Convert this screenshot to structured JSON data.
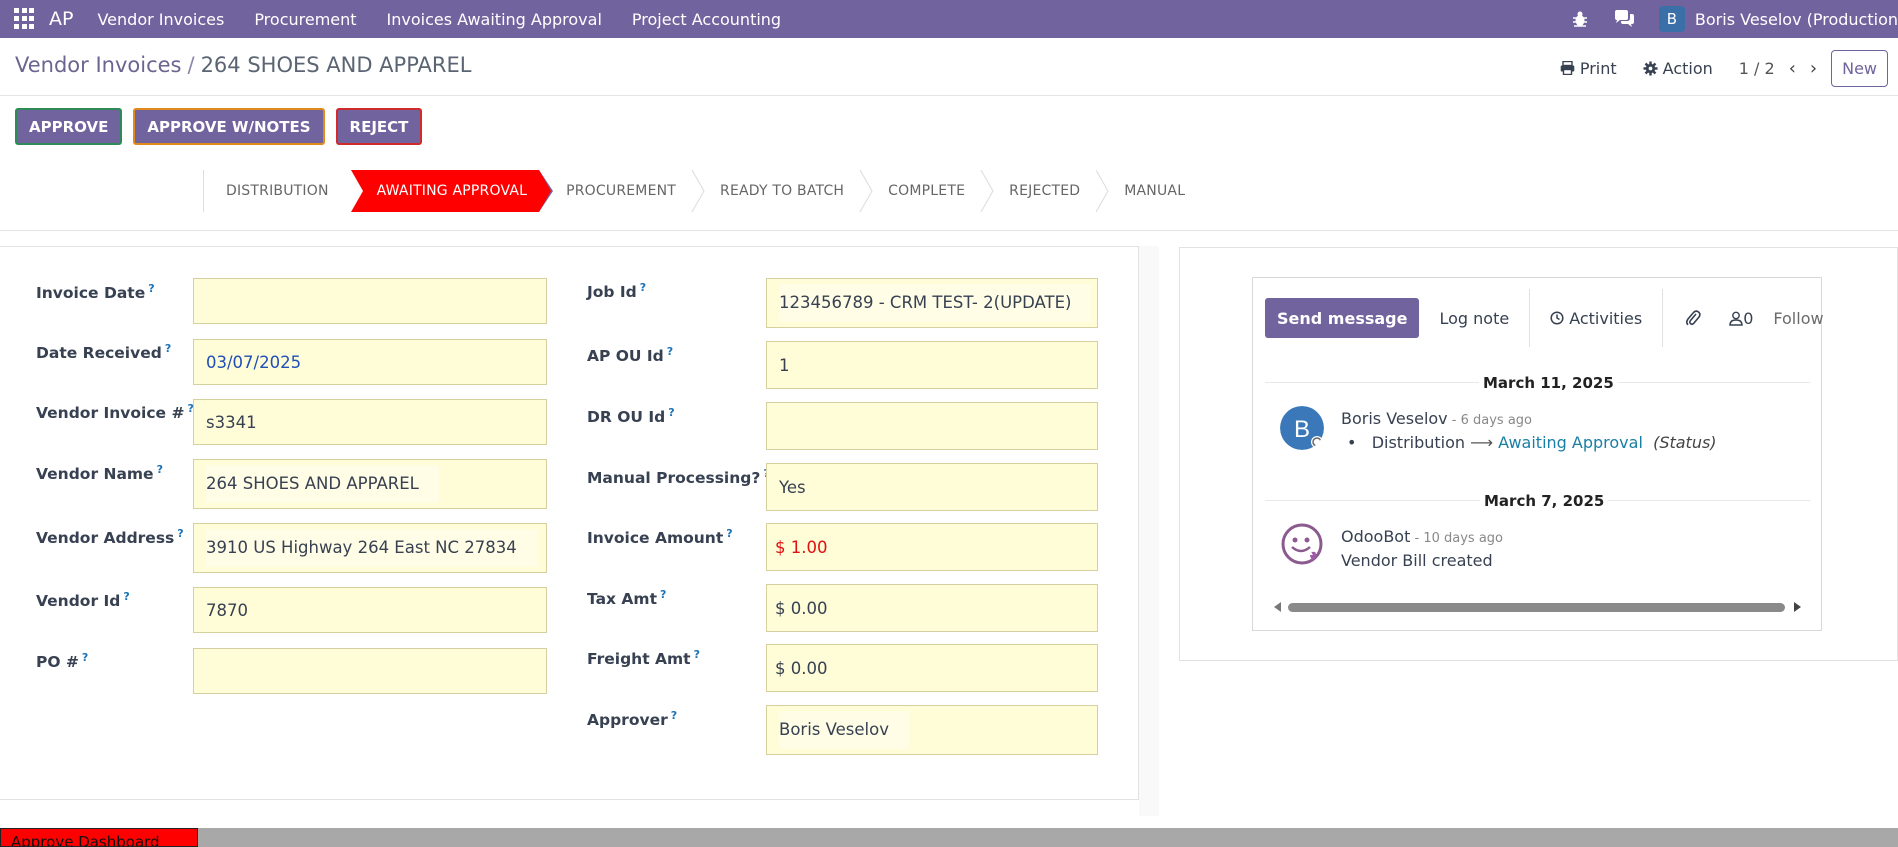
{
  "navbar": {
    "brand": "AP",
    "menu": [
      "Vendor Invoices",
      "Procurement",
      "Invoices Awaiting Approval",
      "Project Accounting"
    ],
    "user_initial": "B",
    "user_name": "Boris Veselov (Production"
  },
  "control_panel": {
    "breadcrumb_parent": "Vendor Invoices",
    "breadcrumb_separator": "/",
    "breadcrumb_current": "264 SHOES AND APPAREL",
    "print_label": "Print",
    "action_label": "Action",
    "pager": "1 / 2",
    "prev": "‹",
    "next": "›",
    "new_label": "New"
  },
  "actions": {
    "approve": "APPROVE",
    "approve_notes": "APPROVE W/NOTES",
    "reject": "REJECT"
  },
  "statusbar": {
    "stages": [
      "DISTRIBUTION",
      "AWAITING APPROVAL",
      "PROCUREMENT",
      "READY TO BATCH",
      "COMPLETE",
      "REJECTED",
      "MANUAL"
    ],
    "active": "AWAITING APPROVAL"
  },
  "form": {
    "left": {
      "invoice_date": {
        "label": "Invoice Date",
        "value": ""
      },
      "date_received": {
        "label": "Date Received",
        "value": "03/07/2025"
      },
      "vendor_invoice": {
        "label": "Vendor Invoice #",
        "value": "s3341"
      },
      "vendor_name": {
        "label": "Vendor Name",
        "value": "264 SHOES AND APPAREL"
      },
      "vendor_address": {
        "label": "Vendor Address",
        "value": "3910 US Highway 264 East  NC 27834"
      },
      "vendor_id": {
        "label": "Vendor Id",
        "value": "7870"
      },
      "po": {
        "label": "PO #",
        "value": ""
      }
    },
    "right": {
      "job_id": {
        "label": "Job Id",
        "value": "123456789 - CRM TEST- 2(UPDATE)"
      },
      "ap_ou_id": {
        "label": "AP OU Id",
        "value": "1"
      },
      "dr_ou_id": {
        "label": "DR OU Id",
        "value": ""
      },
      "manual_processing": {
        "label": "Manual Processing?",
        "value": "Yes"
      },
      "invoice_amount": {
        "label": "Invoice Amount",
        "value": "$ 1.00"
      },
      "tax_amt": {
        "label": "Tax Amt",
        "value": "$ 0.00"
      },
      "freight_amt": {
        "label": "Freight Amt",
        "value": "$ 0.00"
      },
      "approver": {
        "label": "Approver",
        "value": "Boris Veselov"
      }
    },
    "help_marker": "?"
  },
  "chatter": {
    "send_message": "Send message",
    "log_note": "Log note",
    "activities": "Activities",
    "followers_count": "0",
    "follow": "Follow",
    "messages": [
      {
        "date": "March 11, 2025",
        "avatar_initial": "B",
        "author": "Boris Veselov",
        "ago": " - 6 days ago",
        "bullet": "•",
        "from": "Distribution",
        "arrow": "⟶",
        "to": "Awaiting Approval",
        "field": "(Status)"
      },
      {
        "date": "March 7, 2025",
        "author": "OdooBot",
        "ago": " - 10 days ago",
        "body": "Vendor Bill created"
      }
    ]
  },
  "bottom": {
    "red_label": "Approve Dashboard"
  },
  "colors": {
    "brand": "#71639e",
    "active_stage": "#ff0000",
    "field_bg": "#fffcd8",
    "link": "#1a7fa5"
  }
}
